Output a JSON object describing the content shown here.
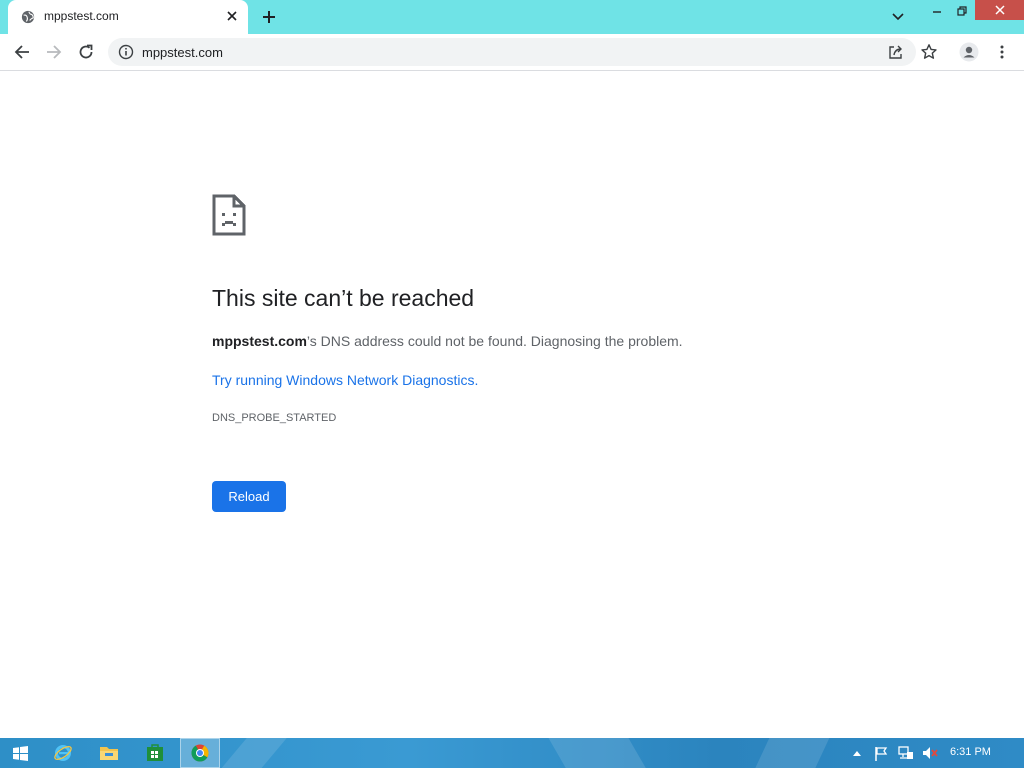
{
  "browser": {
    "tab": {
      "title": "mppstest.com",
      "favicon": "globe-icon"
    },
    "new_tab_icon": "plus-icon",
    "tab_search_icon": "chevron-down-icon",
    "window_controls": [
      "minimize-icon",
      "restore-icon",
      "close-icon"
    ],
    "toolbar": {
      "back_icon": "arrow-left-icon",
      "forward_icon": "arrow-right-icon",
      "reload_icon": "reload-icon",
      "url": "mppstest.com",
      "site_info_icon": "info-icon",
      "share_icon": "share-icon",
      "bookmark_icon": "star-icon",
      "profile_icon": "profile-icon",
      "menu_icon": "kebab-menu-icon"
    },
    "colors": {
      "tab_strip": "#6fe3e6",
      "accent": "#1a73e8"
    }
  },
  "error_page": {
    "icon": "sad-document-icon",
    "title": "This site can’t be reached",
    "domain": "mppstest.com",
    "description_rest": "’s DNS address could not be found. Diagnosing the problem.",
    "link": "Try running Windows Network Diagnostics.",
    "error_code": "DNS_PROBE_STARTED",
    "reload_button": "Reload"
  },
  "taskbar": {
    "start_icon": "windows-start-icon",
    "pinned": [
      "internet-explorer-icon",
      "file-explorer-icon",
      "store-icon",
      "chrome-icon"
    ],
    "active_app": "chrome-icon",
    "tray": [
      "show-hidden-icons-icon",
      "action-center-flag-icon",
      "network-icon",
      "volume-muted-icon"
    ],
    "time": "6:31 PM"
  }
}
